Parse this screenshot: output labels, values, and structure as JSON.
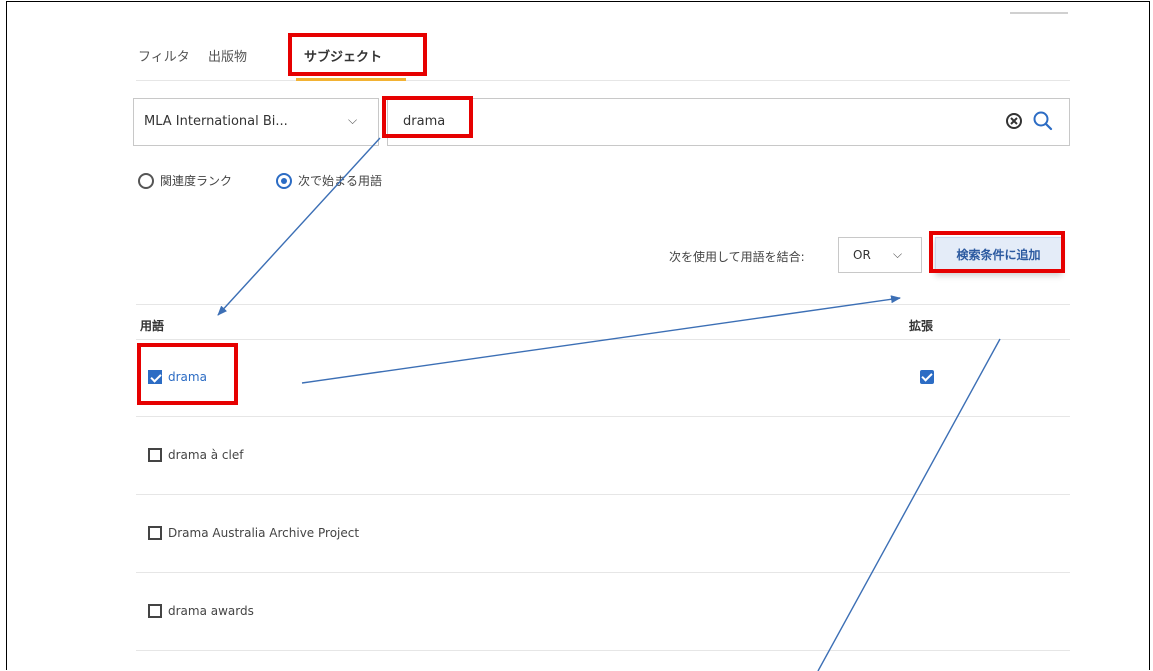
{
  "tabs": [
    {
      "label": "フィルタ"
    },
    {
      "label": "出版物"
    },
    {
      "label": "サブジェクト",
      "active": true
    }
  ],
  "database_select": {
    "value": "MLA International Bi..."
  },
  "search": {
    "value": "drama"
  },
  "radios": [
    {
      "label": "関連度ランク",
      "selected": false
    },
    {
      "label": "次で始まる用語",
      "selected": true
    }
  ],
  "combine": {
    "label": "次を使用して用語を結合:",
    "value": "OR"
  },
  "add_button": {
    "label": "検索条件に追加"
  },
  "table": {
    "headers": {
      "term": "用語",
      "explode": "拡張"
    },
    "rows": [
      {
        "term": "drama",
        "checked": true,
        "explode": true
      },
      {
        "term": "drama à clef",
        "checked": false,
        "explode": false
      },
      {
        "term": "Drama Australia Archive Project",
        "checked": false,
        "explode": false
      },
      {
        "term": "drama awards",
        "checked": false,
        "explode": false
      }
    ]
  },
  "colors": {
    "accent": "#2c6cc4",
    "highlight": "#e60000",
    "tab_underline": "#f2b233",
    "arrow": "#3c6fb5"
  }
}
